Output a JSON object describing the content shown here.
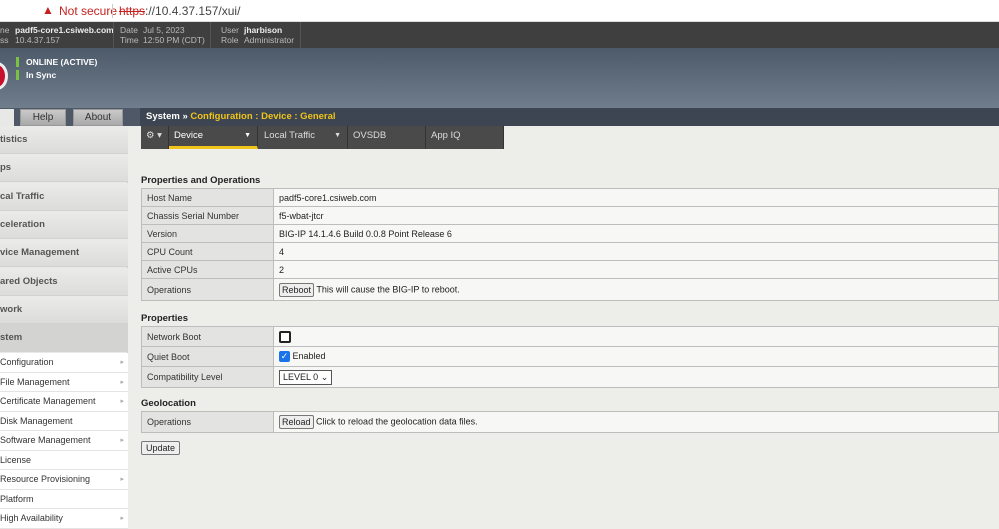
{
  "browser": {
    "warning": "Not secure",
    "url_scheme": "https",
    "url_rest": "://10.4.37.157/xui/"
  },
  "header": {
    "host_label": "ne",
    "host": "padf5-core1.csiweb.com",
    "addr_label": "ss",
    "addr": "10.4.37.157",
    "date_label": "Date",
    "date": "Jul 5, 2023",
    "time_label": "Time",
    "time": "12:50 PM (CDT)",
    "user_label": "User",
    "user": "jharbison",
    "role_label": "Role",
    "role": "Administrator"
  },
  "status": {
    "online": "ONLINE (ACTIVE)",
    "sync": "In Sync"
  },
  "left_tabs": [
    "Help",
    "About"
  ],
  "breadcrumb": {
    "root": "System",
    "sep": "»",
    "path": "Configuration : Device : General"
  },
  "menu": {
    "gear": "⚙ ▾",
    "tabs": [
      "Device",
      "Local Traffic",
      "OVSDB",
      "App IQ"
    ]
  },
  "sidebar": {
    "items": [
      "tistics",
      "ps",
      "cal Traffic",
      "celeration",
      "vice Management",
      "ared Objects",
      "work",
      "stem"
    ],
    "sub": [
      "Configuration",
      "File Management",
      "Certificate Management",
      "Disk Management",
      "Software Management",
      "License",
      "Resource Provisioning",
      "Platform",
      "High Availability"
    ],
    "sub_arrows": [
      true,
      true,
      true,
      false,
      true,
      false,
      true,
      false,
      true
    ]
  },
  "sections": {
    "props_ops": "Properties and Operations",
    "props": "Properties",
    "geo": "Geolocation"
  },
  "props_ops": [
    {
      "label": "Host Name",
      "value": "padf5-core1.csiweb.com"
    },
    {
      "label": "Chassis Serial Number",
      "value": "f5-wbat-jtcr"
    },
    {
      "label": "Version",
      "value": "BIG-IP 14.1.4.6 Build 0.0.8 Point Release 6"
    },
    {
      "label": "CPU Count",
      "value": "4"
    },
    {
      "label": "Active CPUs",
      "value": "2"
    }
  ],
  "operations": {
    "label": "Operations",
    "button": "Reboot",
    "text": "This will cause the BIG-IP to reboot."
  },
  "properties": {
    "network_boot": "Network Boot",
    "quiet_boot": "Quiet Boot",
    "quiet_text": "Enabled",
    "compat": "Compatibility Level",
    "compat_value": "LEVEL 0"
  },
  "geo": {
    "label": "Operations",
    "button": "Reload",
    "text": "Click to reload the geolocation data files."
  },
  "update": "Update"
}
